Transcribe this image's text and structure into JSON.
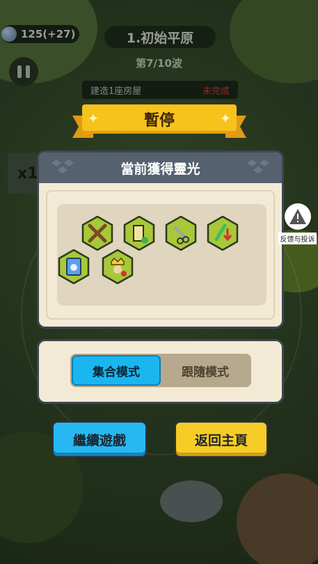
{
  "hud": {
    "coin_text": "125(+27)",
    "level_title": "1.初始平原",
    "wave_text": "第7/10波",
    "task_text": "建造1座房屋",
    "task_status": "未完成",
    "speed_text": "x1"
  },
  "pause": {
    "title": "暫停",
    "aura_title": "當前獲得靈光",
    "auras": [
      {
        "icon": "crossed-swords-icon"
      },
      {
        "icon": "tower-upgrade-icon"
      },
      {
        "icon": "scissors-tool-icon"
      },
      {
        "icon": "sword-downgrade-icon"
      },
      {
        "icon": "rabbit-card-icon"
      },
      {
        "icon": "king-recruit-icon"
      }
    ],
    "modes": {
      "active": "集合模式",
      "inactive": "跟隨模式"
    },
    "continue_label": "繼續遊戲",
    "home_label": "返回主頁"
  },
  "feedback": {
    "label": "反馈与投诉"
  },
  "colors": {
    "panel_bg": "#f3ead6",
    "panel_header": "#56616f",
    "ribbon": "#f8c21d",
    "active_mode": "#19b6f0",
    "continue_btn": "#27b8f2",
    "home_btn": "#f6cc26",
    "hex_fill": "#a8c83a"
  }
}
